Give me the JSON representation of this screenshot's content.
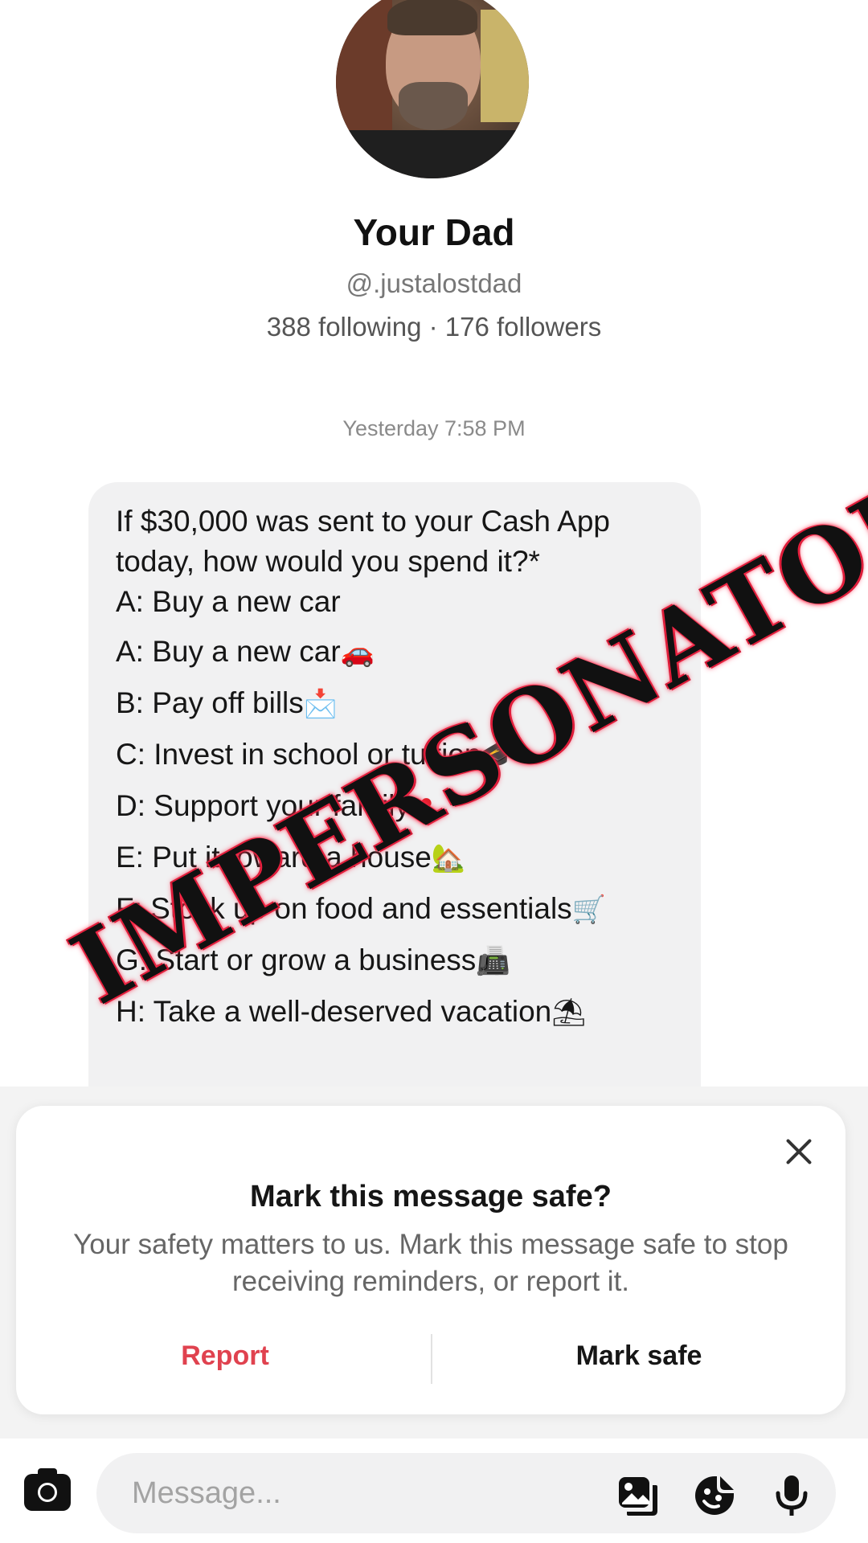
{
  "profile": {
    "name": "Your Dad",
    "handle": "@.justalostdad",
    "stats": "388 following · 176 followers"
  },
  "conversation": {
    "timestamp": "Yesterday 7:58 PM",
    "message_lines": [
      {
        "text": "If $30,000 was sent to your Cash App",
        "emoji": ""
      },
      {
        "text": "today, how would you spend it?*",
        "emoji": ""
      },
      {
        "text": "A: Buy a new car",
        "emoji": ""
      },
      {
        "text": "A: Buy a new car",
        "emoji": "🚗"
      },
      {
        "text": "B: Pay off bills",
        "emoji": "📩"
      },
      {
        "text": "C: Invest in school or tuition",
        "emoji": "🎓"
      },
      {
        "text": "D: Support your family",
        "emoji": "❤"
      },
      {
        "text": "E: Put it toward a house",
        "emoji": "🏡"
      },
      {
        "text": "F: Stock up on food and essentials",
        "emoji": "🛒"
      },
      {
        "text": "G: Start or grow a business",
        "emoji": "📠"
      },
      {
        "text": "H: Take a well-deserved vacation",
        "emoji": "⛱"
      }
    ]
  },
  "watermark": {
    "text": "IMPERSONATOR"
  },
  "safety_prompt": {
    "title": "Mark this message safe?",
    "body": "Your safety matters to us. Mark this message safe to stop receiving reminders, or report it.",
    "report_label": "Report",
    "mark_safe_label": "Mark safe",
    "close_icon": "close-icon"
  },
  "composer": {
    "placeholder": "Message...",
    "icons": [
      "camera-icon",
      "gallery-icon",
      "sticker-icon",
      "microphone-icon"
    ]
  },
  "colors": {
    "report": "#e0424f",
    "bubble": "#f1f1f2",
    "watermark_glow": "#ff2a4a"
  }
}
